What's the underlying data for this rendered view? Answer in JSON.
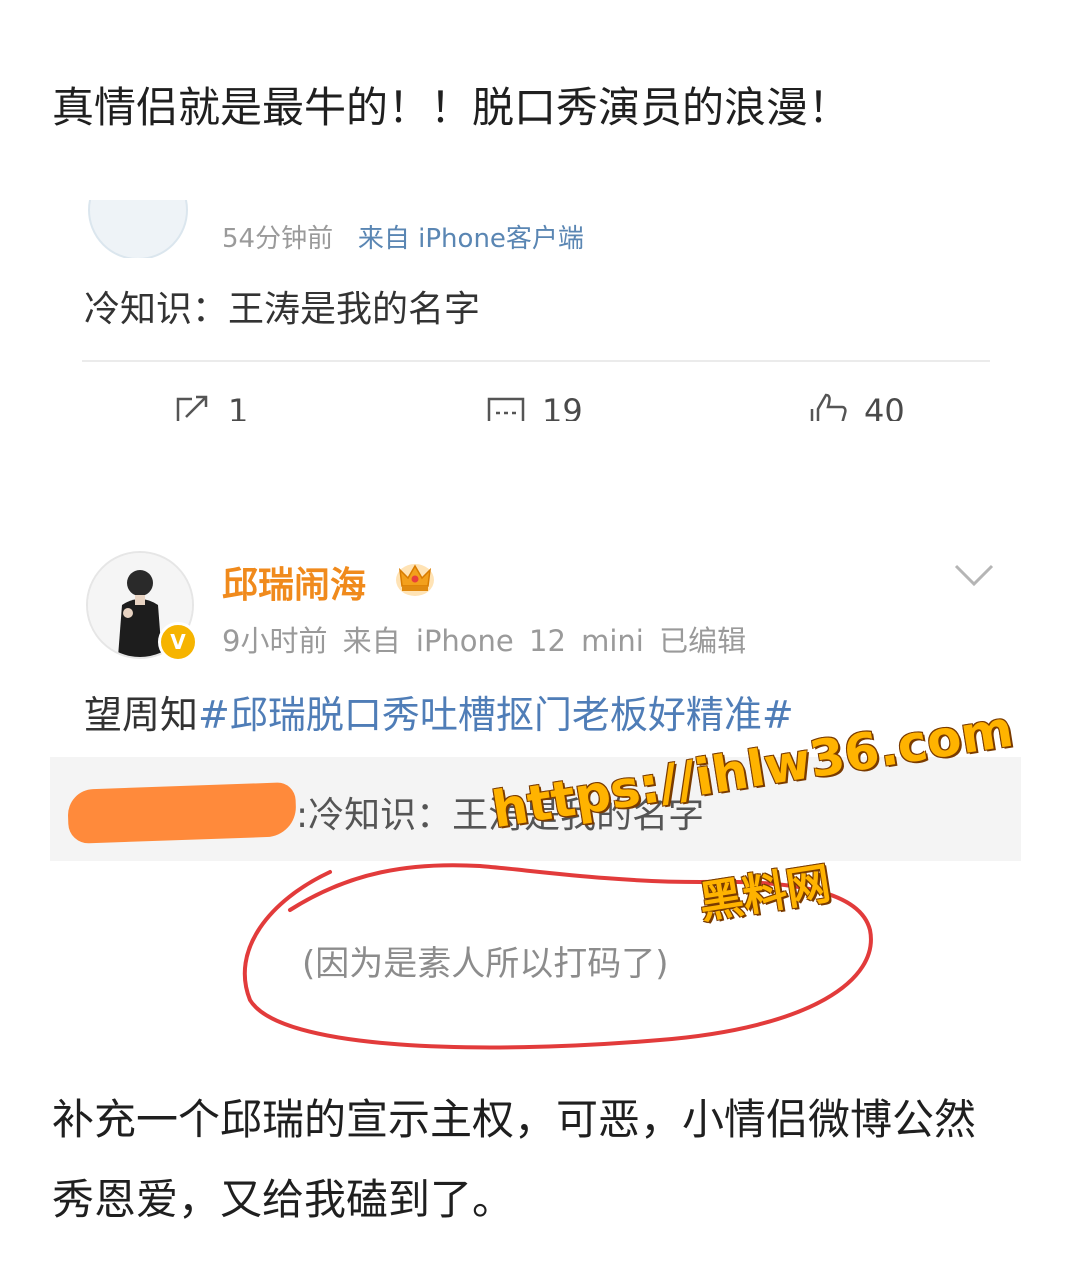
{
  "headline": "真情侣就是最牛的！！脱口秀演员的浪漫！",
  "post_top": {
    "meta_time": "54分钟前",
    "meta_source": "来自 iPhone客户端",
    "text": "冷知识：王涛是我的名字",
    "actions": {
      "repost_count": "1",
      "comment_count": "19",
      "like_count": "40"
    }
  },
  "post_main": {
    "username": "邱瑞闹海",
    "meta": "9小时前   来自 iPhone 12 mini   已编辑",
    "text_prefix": "望周知",
    "hashtag": "#邱瑞脱口秀吐槽抠门老板好精准#",
    "repost_text": ":冷知识：王涛是我的名字",
    "icons": [
      "crown-icon",
      "verified-icon",
      "chevron-down-icon"
    ]
  },
  "note": "(因为是素人所以打码了)",
  "watermark": {
    "url": "https://ihlw36.com",
    "name": "黑料网"
  },
  "closing": "补充一个邱瑞的宣示主权，可恶，小情侣微博公然秀恩爱，又给我磕到了。",
  "colors": {
    "username": "#f08a1c",
    "hashtag": "#4f7db7",
    "annotation_circle": "#e23b3b",
    "redaction": "#ff8a3b"
  }
}
